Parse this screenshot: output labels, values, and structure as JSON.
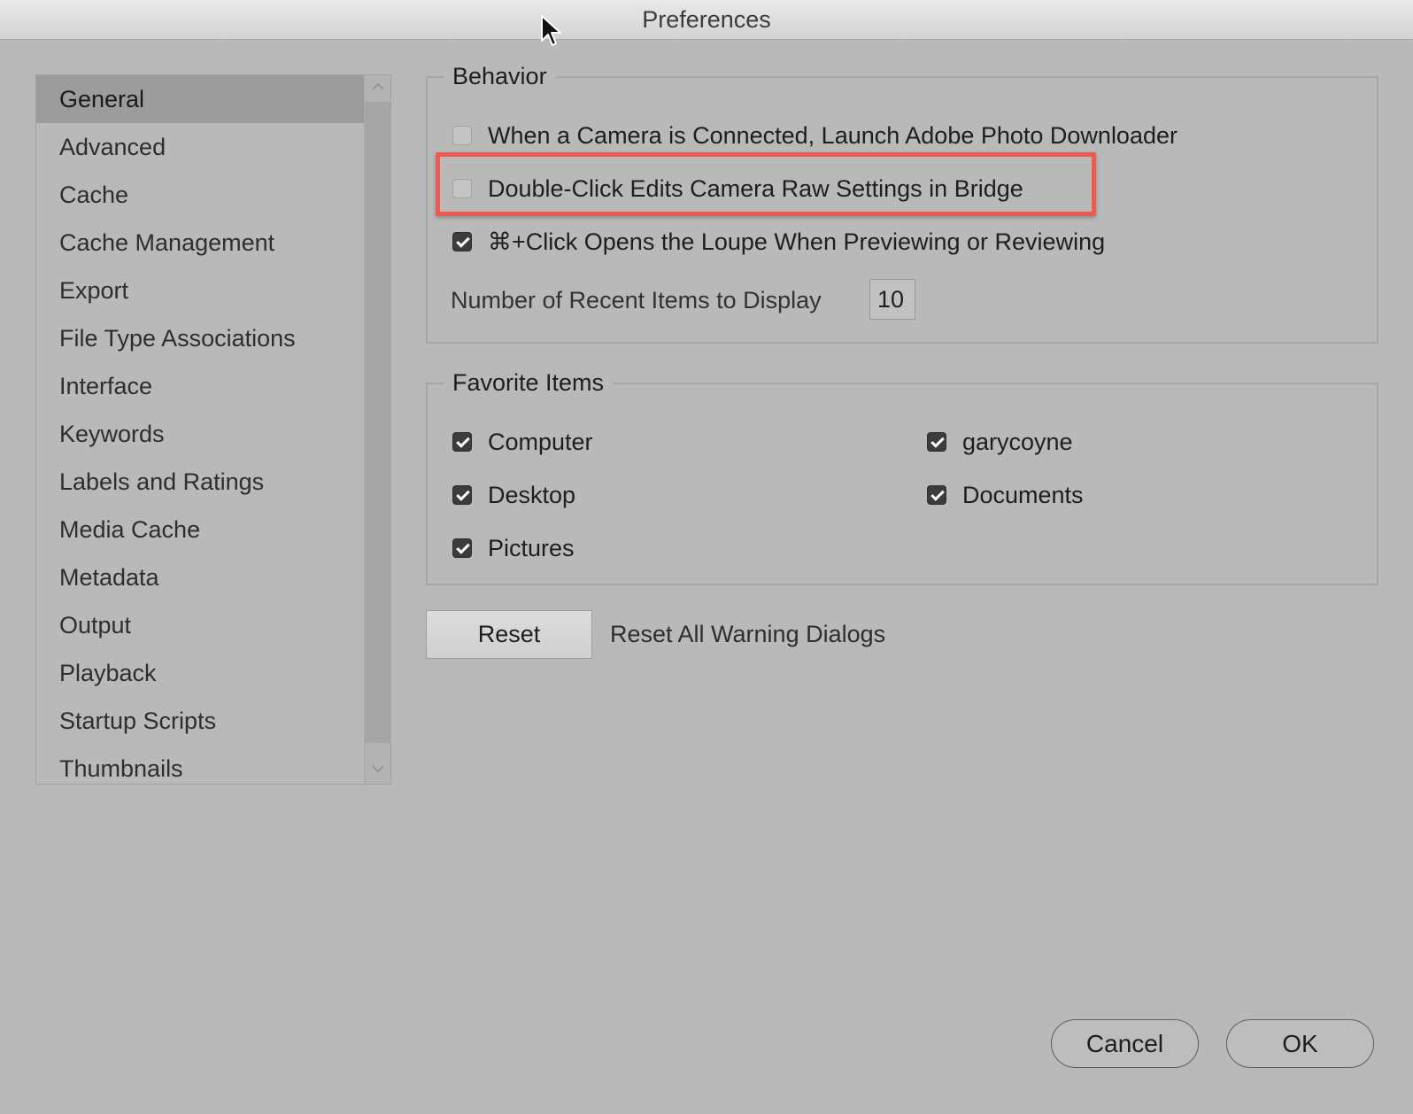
{
  "window": {
    "title": "Preferences"
  },
  "sidebar": {
    "items": [
      {
        "label": "General",
        "selected": true
      },
      {
        "label": "Advanced"
      },
      {
        "label": "Cache"
      },
      {
        "label": "Cache Management"
      },
      {
        "label": "Export"
      },
      {
        "label": "File Type Associations"
      },
      {
        "label": "Interface"
      },
      {
        "label": "Keywords"
      },
      {
        "label": "Labels and Ratings"
      },
      {
        "label": "Media Cache"
      },
      {
        "label": "Metadata"
      },
      {
        "label": "Output"
      },
      {
        "label": "Playback"
      },
      {
        "label": "Startup Scripts"
      },
      {
        "label": "Thumbnails"
      }
    ]
  },
  "behavior": {
    "title": "Behavior",
    "options": [
      {
        "label": "When a Camera is Connected, Launch Adobe Photo Downloader",
        "checked": false
      },
      {
        "label": "Double-Click Edits Camera Raw Settings in Bridge",
        "checked": false,
        "highlighted": true
      },
      {
        "label": "⌘+Click Opens the Loupe When Previewing or Reviewing",
        "checked": true
      }
    ],
    "recent_items_label": "Number of Recent Items to Display",
    "recent_items_value": "10"
  },
  "favorites": {
    "title": "Favorite Items",
    "items": [
      {
        "label": "Computer",
        "checked": true
      },
      {
        "label": "garycoyne",
        "checked": true
      },
      {
        "label": "Desktop",
        "checked": true
      },
      {
        "label": "Documents",
        "checked": true
      },
      {
        "label": "Pictures",
        "checked": true
      }
    ]
  },
  "reset": {
    "button_label": "Reset",
    "description": "Reset All Warning Dialogs"
  },
  "footer": {
    "cancel_label": "Cancel",
    "ok_label": "OK"
  },
  "colors": {
    "highlight": "#ee5a52",
    "background": "#b9b9b9",
    "selected_item": "#9c9c9c"
  },
  "icons": {
    "cursor": "arrow-cursor-icon",
    "scroll_up": "chevron-up-icon",
    "scroll_down": "chevron-down-icon"
  }
}
